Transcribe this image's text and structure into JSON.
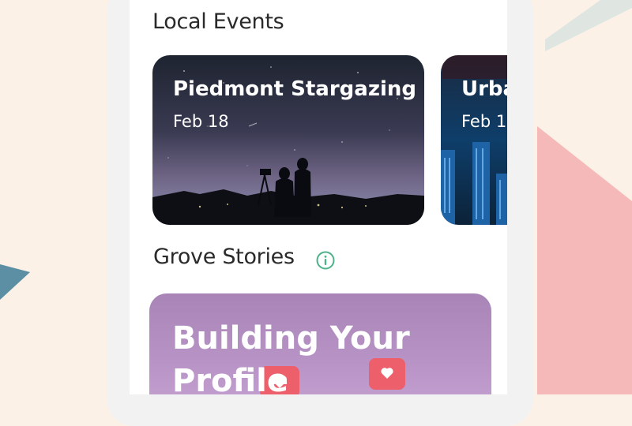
{
  "sections": {
    "local_events": {
      "title": "Local Events"
    },
    "grove_stories": {
      "title": "Grove Stories"
    }
  },
  "events": [
    {
      "title": "Piedmont Stargazing",
      "date": "Feb  18"
    },
    {
      "title": "Urba",
      "date": "Feb 1"
    }
  ],
  "stories": [
    {
      "title_line1": "Building Your",
      "title_line2": "Profile"
    }
  ],
  "colors": {
    "background": "#fbf1e6",
    "accent_pink": "#f4b9b8",
    "accent_teal": "#5c8fa4",
    "info_icon": "#4db28a",
    "story_purple": "#b894c6",
    "heart_badge": "#ec5f6b"
  }
}
